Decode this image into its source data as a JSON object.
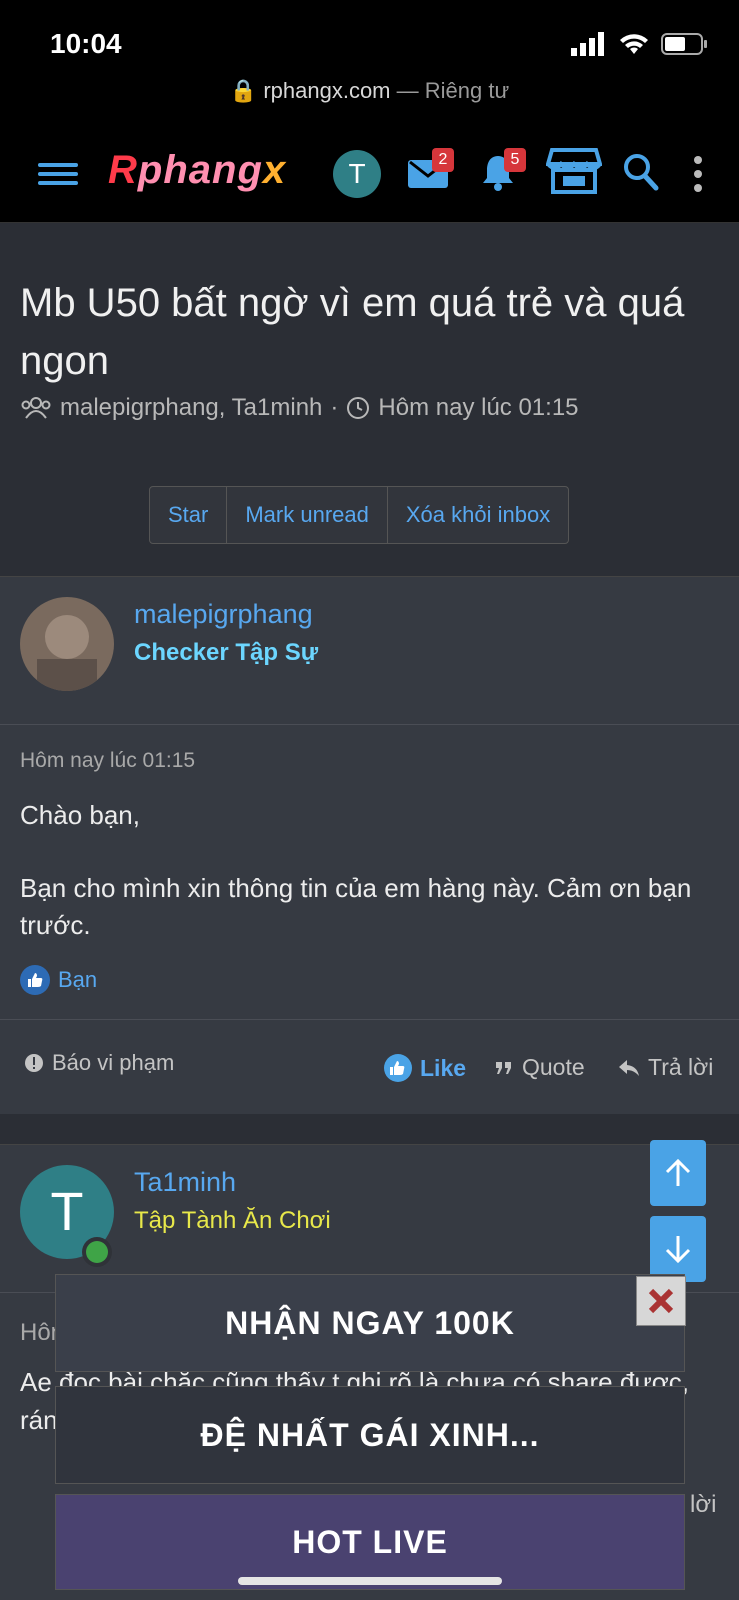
{
  "status_bar": {
    "time": "10:04"
  },
  "browser": {
    "domain": "rphangx.com",
    "separator": " — ",
    "privacy": "Riêng tư"
  },
  "header": {
    "logo": {
      "r": "R",
      "mid": "phang",
      "x": "x"
    },
    "user_initial": "T",
    "messages_count": "2",
    "alerts_count": "5"
  },
  "conversation": {
    "title": "Mb U50 bất ngờ vì em quá trẻ và quá ngon",
    "participants": "malepigrphang, Ta1minh",
    "meta_sep": " · ",
    "time": "Hôm nay lúc 01:15",
    "buttons": {
      "star": "Star",
      "mark_unread": "Mark unread",
      "remove": "Xóa khỏi inbox"
    }
  },
  "message1": {
    "author": "malepigrphang",
    "user_title": "Checker Tập Sự",
    "date": "Hôm nay lúc 01:15",
    "greeting": "Chào bạn,",
    "body": "Bạn cho mình xin thông tin của em hàng này. Cảm ơn bạn trước.",
    "likes_by": "Bạn",
    "actions": {
      "report": "Báo vi phạm",
      "like": "Like",
      "quote": "Quote",
      "reply": "Trả lời"
    }
  },
  "message2": {
    "author_initial": "T",
    "author": "Ta1minh",
    "user_title": "Tập Tành Ăn Chơi",
    "date_partial": "Hôn",
    "body_partial": "Ae đọc bài chắc cũng thấy t ghi rõ là chưa có share được,",
    "body_partial2": "rán",
    "reply_partial": "lời"
  },
  "ads": {
    "ad1_text": "NHẬN NGAY 100K",
    "ad2_text": "ĐỆ NHẤT GÁI XINH...",
    "ad3_text": "HOT LIVE"
  },
  "colors": {
    "accent": "#4aa3e6",
    "link": "#58a8f0",
    "badge": "#d6363b"
  }
}
